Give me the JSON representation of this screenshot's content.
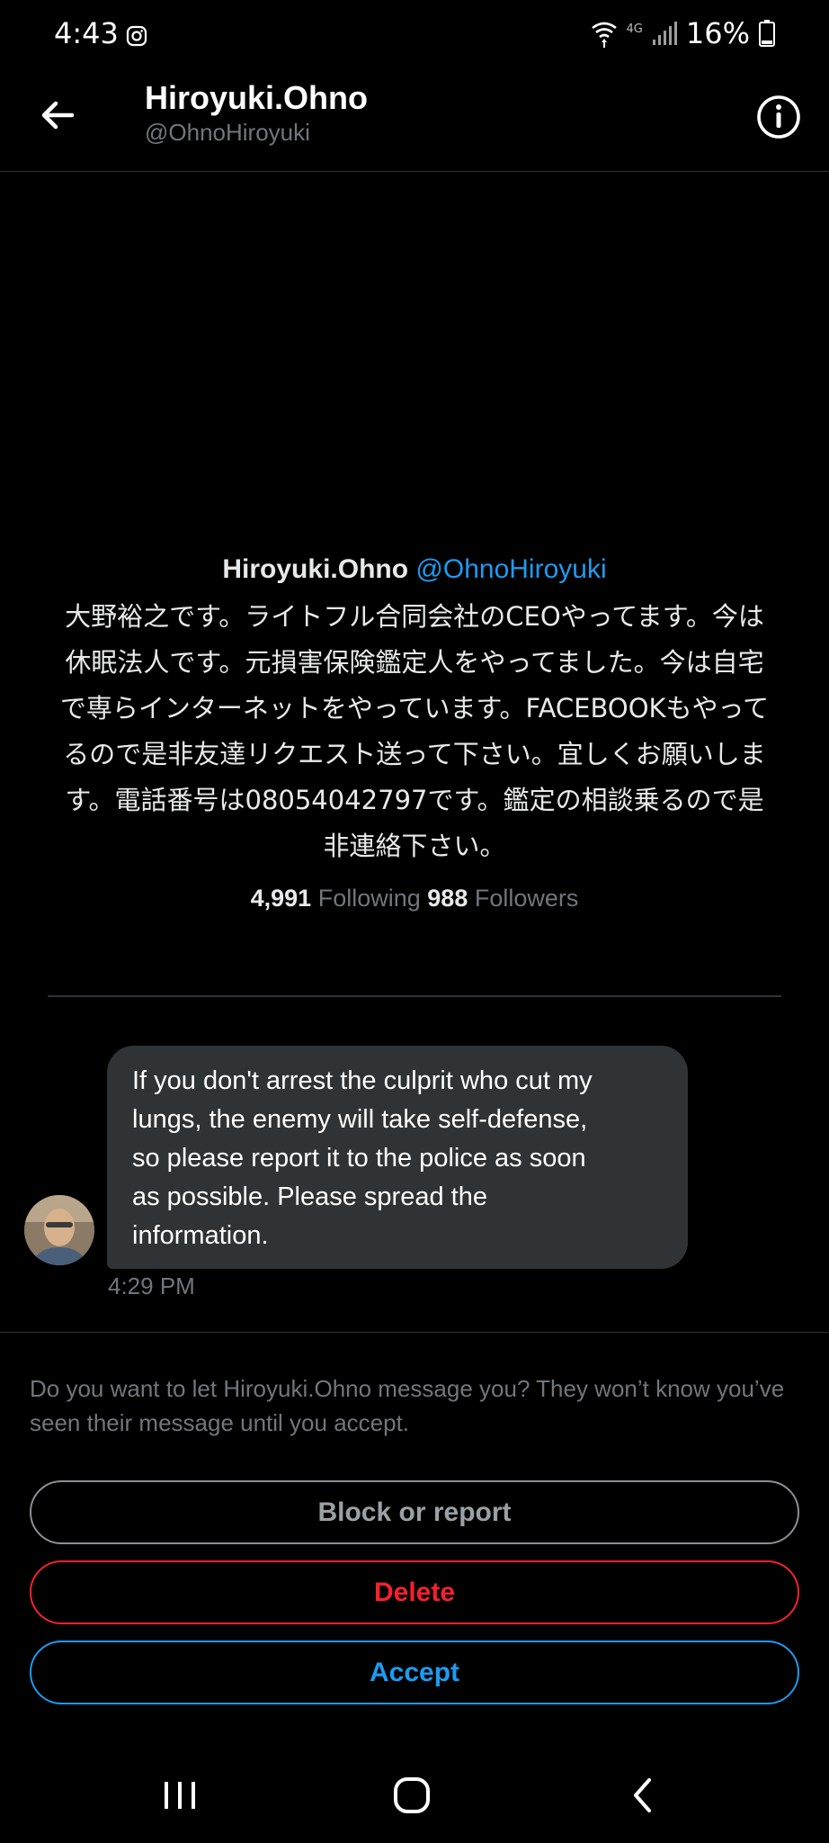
{
  "status_bar": {
    "time": "4:43",
    "network": "4G",
    "battery": "16%"
  },
  "header": {
    "name": "Hiroyuki.Ohno",
    "handle": "@OhnoHiroyuki"
  },
  "profile": {
    "name": "Hiroyuki.Ohno",
    "handle": "@OhnoHiroyuki",
    "bio_lines": [
      "大野裕之です。ライトフル合同会社のCEOやってます。今は",
      "休眠法人です。元損害保険鑑定人をやってました。今は自宅",
      "で専らインターネットをやっています。FACEBOOKもやって",
      "るので是非友達リクエスト送って下さい。宜しくお願いしま",
      "す。電話番号は08054042797です。鑑定の相談乗るので是",
      "非連絡下さい。"
    ],
    "following_count": "4,991",
    "following_label": "Following",
    "followers_count": "988",
    "followers_label": "Followers"
  },
  "message": {
    "lines": [
      "If you don't arrest the culprit who cut my",
      "lungs, the enemy will take self-defense,",
      "so please report it to the police as soon",
      "as possible. Please spread the",
      "information."
    ],
    "time": "4:29 PM"
  },
  "request": {
    "text": "Do you want to let Hiroyuki.Ohno message you? They won’t know you’ve seen their message until you accept.",
    "block_label": "Block or report",
    "delete_label": "Delete",
    "accept_label": "Accept"
  },
  "colors": {
    "background": "#000000",
    "link": "#1d9bf0",
    "danger": "#f4212e",
    "bubble": "#2f3336",
    "muted": "#71767b"
  },
  "icons": {
    "back": "arrow-left-icon",
    "info": "info-circle-icon",
    "nav_recent": "recent-apps-icon",
    "nav_home": "home-icon",
    "nav_back": "chevron-left-icon"
  }
}
